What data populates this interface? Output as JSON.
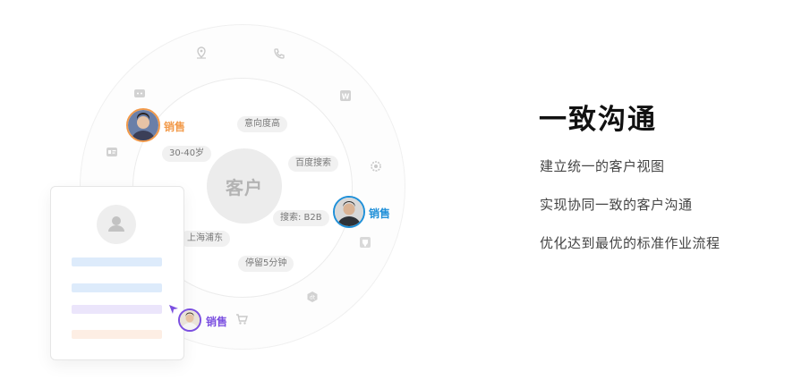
{
  "diagram": {
    "center_label": "客户",
    "tags": [
      "意向度高",
      "30-40岁",
      "百度搜索",
      "搜索: B2B",
      "上海浦东",
      "停留5分钟"
    ],
    "sales_labels": [
      "销售",
      "销售",
      "销售"
    ],
    "colors": {
      "orange": "#f29a4a",
      "blue": "#1e8fd8",
      "purple": "#7b4fe0"
    }
  },
  "heading": "一致沟通",
  "points": [
    "建立统一的客户视图",
    "实现协同一致的客户沟通",
    "优化达到最优的标准作业流程"
  ]
}
